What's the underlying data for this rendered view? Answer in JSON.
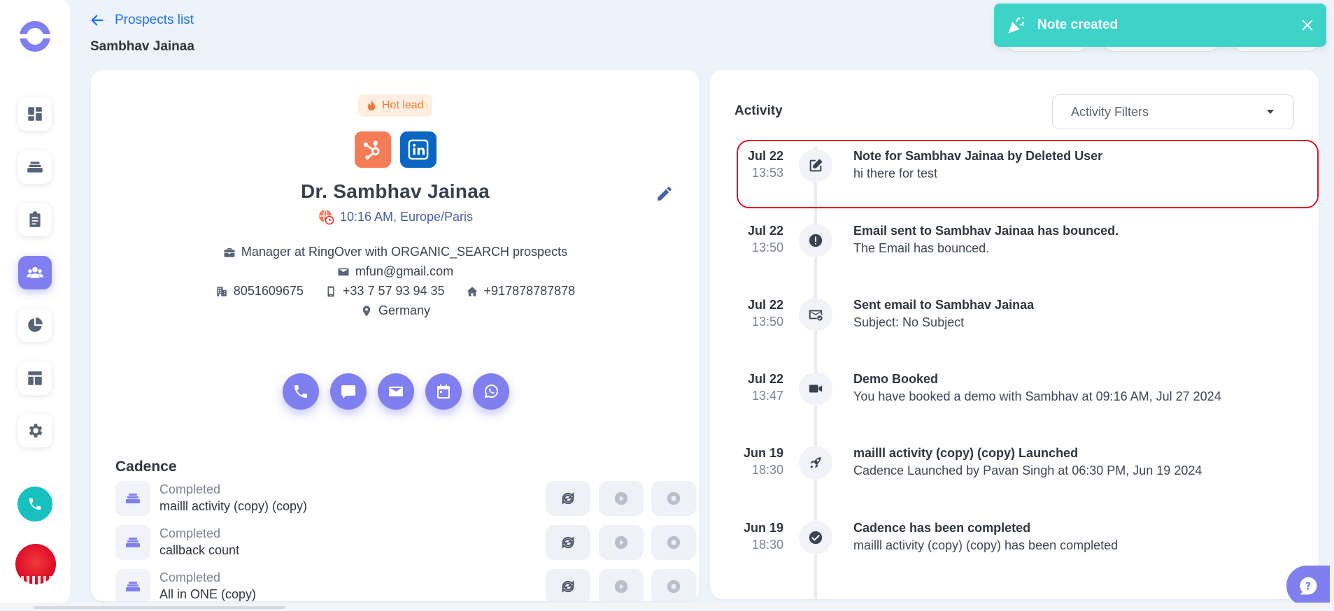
{
  "header": {
    "back_label": "Prospects list",
    "title": "Sambhav Jainaa"
  },
  "toast": {
    "message": "Note created",
    "color": "#3ed3c9"
  },
  "sidebar": {
    "items": [
      {
        "name": "dashboard-icon"
      },
      {
        "name": "cadence-stack-icon"
      },
      {
        "name": "tasks-clipboard-icon"
      },
      {
        "name": "people-icon",
        "active": true
      },
      {
        "name": "pie-chart-icon"
      },
      {
        "name": "layout-icon"
      },
      {
        "name": "gear-icon"
      }
    ],
    "accent": "#7f7ff0"
  },
  "prospect": {
    "badge": "Hot lead",
    "name": "Dr. Sambhav Jainaa",
    "timezone": "10:16 AM, Europe/Paris",
    "job": "Manager at RingOver with ORGANIC_SEARCH prospects",
    "email": "mfun@gmail.com",
    "phone_work": "8051609675",
    "phone_mobile": "+33 7 57 93 94 35",
    "phone_home": "+917878787878",
    "location": "Germany"
  },
  "cadence": {
    "title": "Cadence",
    "items": [
      {
        "status": "Completed",
        "name": "mailll activity (copy) (copy)"
      },
      {
        "status": "Completed",
        "name": "callback count"
      },
      {
        "status": "Completed",
        "name": "All in ONE (copy)"
      }
    ]
  },
  "activity": {
    "title": "Activity",
    "filter_label": "Activity Filters",
    "events": [
      {
        "date": "Jul 22",
        "time": "13:53",
        "icon": "note-edit-icon",
        "title": "Note for Sambhav Jainaa by Deleted User",
        "desc": "hi there for test"
      },
      {
        "date": "Jul 22",
        "time": "13:50",
        "icon": "alert-icon",
        "title": "Email sent to Sambhav Jainaa has bounced.",
        "desc": "The Email has bounced."
      },
      {
        "date": "Jul 22",
        "time": "13:50",
        "icon": "mail-sent-icon",
        "title": "Sent email to Sambhav Jainaa",
        "desc": "Subject: No Subject"
      },
      {
        "date": "Jul 22",
        "time": "13:47",
        "icon": "video-icon",
        "title": "Demo Booked",
        "desc": "You have booked a demo with Sambhav at 09:16 AM, Jul 27 2024"
      },
      {
        "date": "Jun 19",
        "time": "18:30",
        "icon": "rocket-icon",
        "title": "mailll activity (copy) (copy) Launched",
        "desc": "Cadence Launched by Pavan Singh at 06:30 PM, Jun 19 2024"
      },
      {
        "date": "Jun 19",
        "time": "18:30",
        "icon": "check-icon",
        "title": "Cadence has been completed",
        "desc": "mailll activity (copy) (copy) has been completed"
      }
    ]
  }
}
